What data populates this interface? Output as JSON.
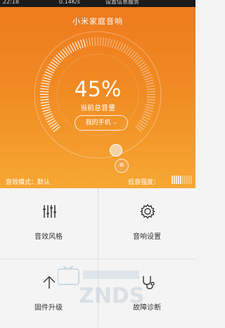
{
  "status_bar": {
    "time": "22:18",
    "network_speed": "0.14K/s",
    "carrier": "设置信息服务"
  },
  "app": {
    "title": "小米家庭音响"
  },
  "volume": {
    "value_text": "45%",
    "level": 0.45,
    "caption": "当前总音量"
  },
  "device_selector": {
    "label": "我的手机",
    "icon": "chevron-down-icon"
  },
  "knob_icon": "menu-lines-icon",
  "sound_mode": {
    "label": "音效模式：默认"
  },
  "bass": {
    "label": "低音强度：",
    "bars_total": 10,
    "bars_active": 5
  },
  "menu": [
    {
      "label": "音效风格",
      "icon": "equalizer-icon"
    },
    {
      "label": "音响设置",
      "icon": "gear-icon"
    },
    {
      "label": "固件升级",
      "icon": "up-arrow-icon"
    },
    {
      "label": "故障诊断",
      "icon": "stethoscope-icon"
    }
  ],
  "colors": {
    "accent": "#ef7d1f",
    "accent_light": "#f6a733",
    "text_dark": "#333333"
  }
}
